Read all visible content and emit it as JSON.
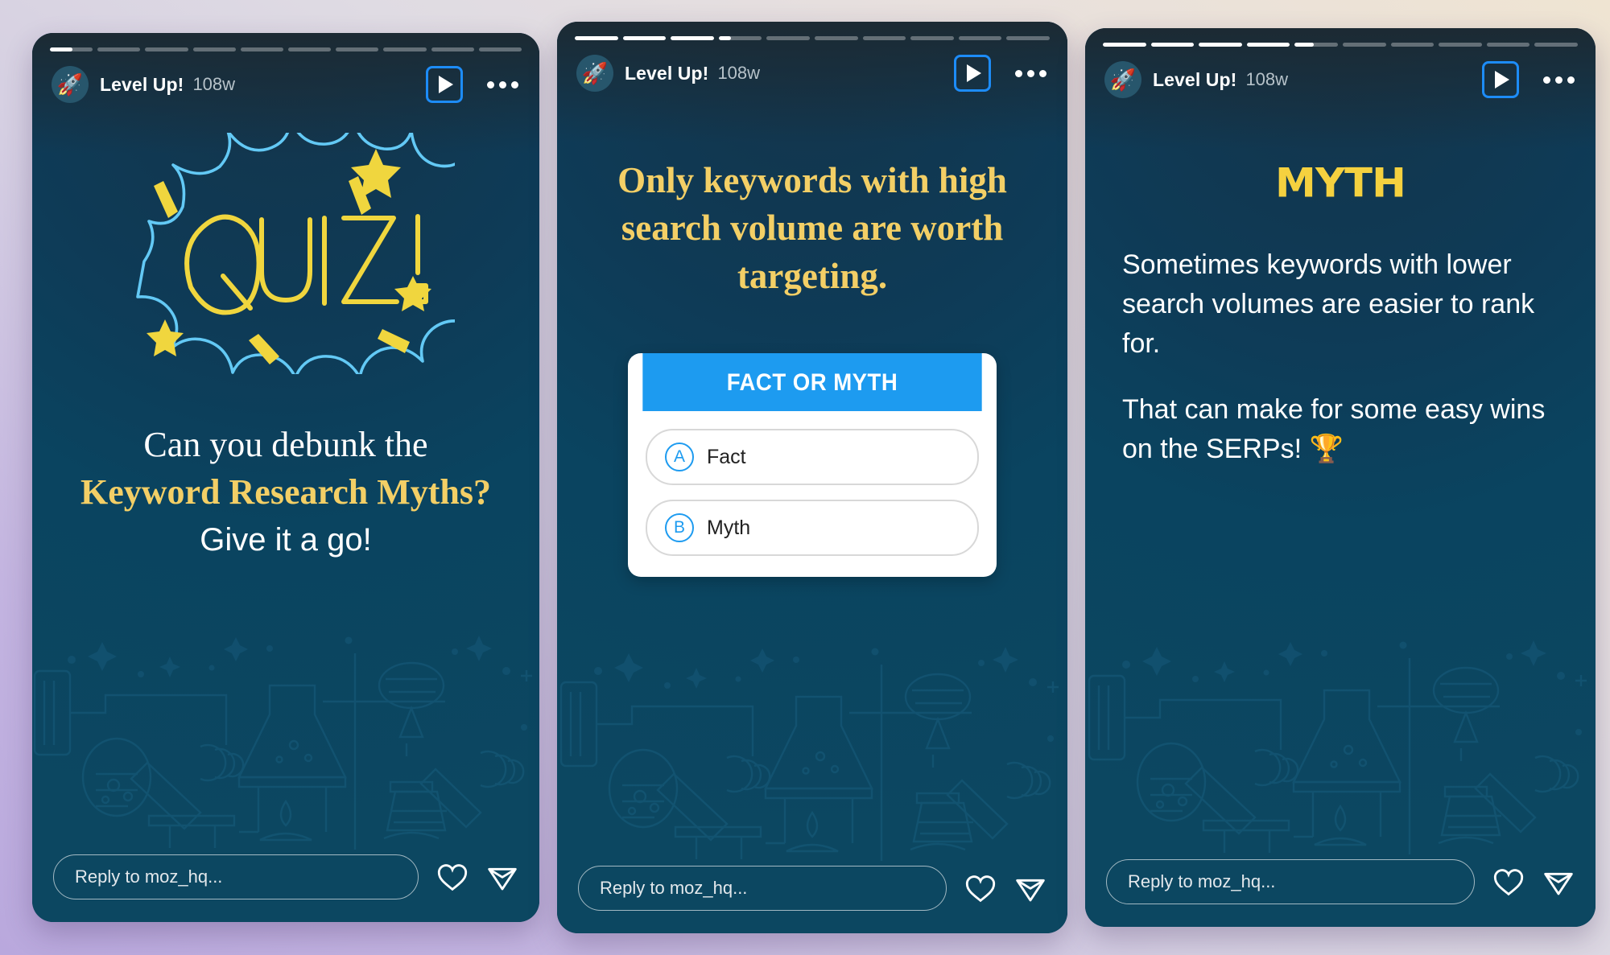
{
  "page": {
    "background_top_right": "#efe4d2",
    "background_bottom_left": "#b9a8dd",
    "accent_blue": "#1d9bf0",
    "accent_yellow": "#f3cf66",
    "story_bg": "#0c4761"
  },
  "account": {
    "name": "Level Up!",
    "time": "108w",
    "avatar_icon": "rocket-icon"
  },
  "controls": {
    "play_icon": "play-icon",
    "more_icon": "more-options-icon",
    "like_icon": "heart-icon",
    "share_icon": "send-icon"
  },
  "footer": {
    "reply_placeholder": "Reply to moz_hq..."
  },
  "stories": [
    {
      "id": "story-quiz-intro",
      "progress": {
        "total": 10,
        "filled": 0,
        "partial_index": 0,
        "partial_pct": 52
      },
      "graphic": {
        "name": "quiz-burst-graphic",
        "word": "QUIZ!"
      },
      "text": {
        "line1": "Can you debunk the",
        "line2": "Keyword Research Myths?",
        "line3": "Give it a go!"
      }
    },
    {
      "id": "story-question",
      "progress": {
        "total": 10,
        "filled": 3,
        "partial_index": 3,
        "partial_pct": 28
      },
      "headline": "Only keywords with high search volume are worth targeting.",
      "quiz_card": {
        "header": "FACT OR MYTH",
        "options": [
          {
            "letter": "A",
            "label": "Fact"
          },
          {
            "letter": "B",
            "label": "Myth"
          }
        ]
      }
    },
    {
      "id": "story-answer",
      "progress": {
        "total": 10,
        "filled": 4,
        "partial_index": 4,
        "partial_pct": 45
      },
      "verdict": "MYTH",
      "body": [
        "Sometimes keywords with lower search volumes are easier to rank for.",
        "That can make for some easy wins on the SERPs! 🏆"
      ]
    }
  ]
}
